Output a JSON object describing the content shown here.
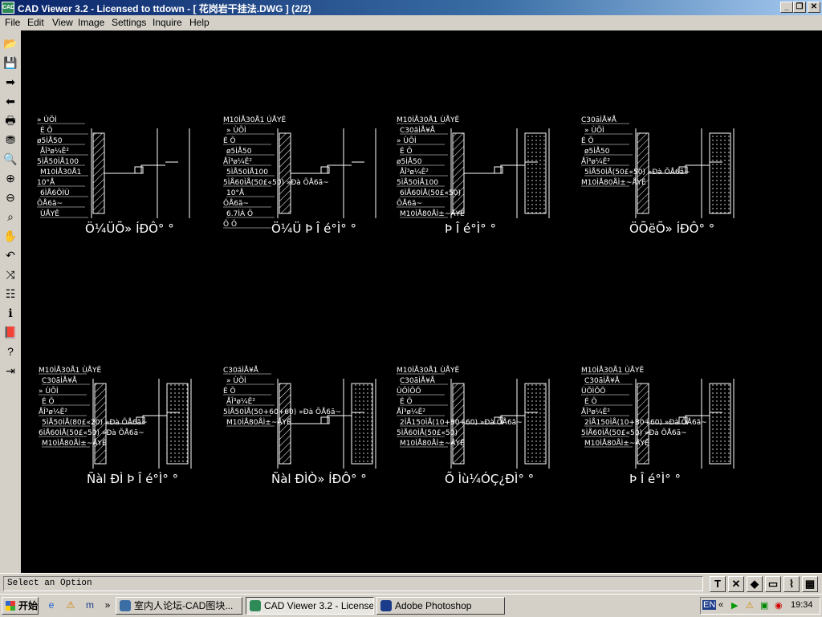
{
  "window": {
    "title": "CAD Viewer 3.2 - Licensed to  ttdown  - [ 花岗岩干挂法.DWG ] (2/2)",
    "app_icon": "CAD",
    "controls": [
      "_",
      "❐",
      "✕"
    ]
  },
  "menu": [
    "File",
    "Edit",
    "View",
    "Image",
    "Settings",
    "Inquire",
    "Help"
  ],
  "toolbar": [
    {
      "icon": "open-icon",
      "glyph": "📂"
    },
    {
      "icon": "save-icon",
      "glyph": "💾"
    },
    {
      "icon": "next-arrow-icon",
      "glyph": "➡"
    },
    {
      "icon": "prev-arrow-icon",
      "glyph": "⬅"
    },
    {
      "icon": "print-icon",
      "glyph": "🖶"
    },
    {
      "icon": "binoculars-icon",
      "glyph": "⛃"
    },
    {
      "icon": "zoom-icon",
      "glyph": "🔍"
    },
    {
      "icon": "zoom-in-icon",
      "glyph": "⊕"
    },
    {
      "icon": "zoom-out-icon",
      "glyph": "⊖"
    },
    {
      "icon": "zoom-window-icon",
      "glyph": "⌕"
    },
    {
      "icon": "pan-hand-icon",
      "glyph": "✋"
    },
    {
      "icon": "undo-icon",
      "glyph": "↶"
    },
    {
      "icon": "rotate-icon",
      "glyph": "⤨"
    },
    {
      "icon": "layers-icon",
      "glyph": "☷"
    },
    {
      "icon": "info-icon",
      "glyph": "ℹ"
    },
    {
      "icon": "book-icon",
      "glyph": "📕"
    },
    {
      "icon": "help-icon",
      "glyph": "?"
    },
    {
      "icon": "exit-icon",
      "glyph": "⇥"
    }
  ],
  "drawing": {
    "row1": [
      {
        "caption": "Ö¼ÜÕ» ÍÐÔ°   °",
        "labels": [
          "»  ÙÕÌ",
          "É  Ö",
          "ø5ÌÅ50",
          "ÅÎ³ø¼Ê²",
          "5ÌÅ50ÌÅ100",
          "M10ÌÅ30Å1",
          "10°Å",
          "6ÌÅ6ÖÌÙ",
          "ÔÅ6ã~",
          "ÙÅYÊ"
        ]
      },
      {
        "caption": "Ö¼Ü  Þ  Î   é°Ì°   °",
        "labels": [
          "M10ÌÅ30Å1  ÙÅYÊ",
          "»  ÙÕÌ",
          "É  Ö",
          "ø5ÌÅ50",
          "ÅÎ³ø¼Ê²",
          "5ÌÅ50ÌÅ100",
          "5ÌÅ60ÌÅ(50£«50)  »Ðà  ÕÅ6ã~",
          "10°Å",
          "ÔÅ6ã~",
          "6.7ÌÁ Ö",
          "Ö  Ö"
        ]
      },
      {
        "caption": "Þ  Î   é°Ì°   °",
        "labels": [
          "M10ÌÅ30Å1  ÙÅYÊ",
          "C30ãÌÅ¥Å",
          "»  ÙÕÌ",
          "É  Ö",
          "ø5ÌÅ50",
          "ÅÎ³ø¼Ê²",
          "5ÌÅ50ÌÅ100",
          "6ÌÅ60ÌÅ(50£«50)",
          "ÔÅ6ã~",
          "M10ÌÅ80ÅÌ±~ÅYÊ"
        ]
      },
      {
        "caption": "ÖÕëÕ» ÍÐÔ°   °",
        "labels": [
          "C30ãÌÅ¥Å",
          "»  ÙÕÌ",
          "É  Ö",
          "ø5ÌÅ50",
          "ÅÎ³ø¼Ê²",
          "5ÌÅ50ÌÅ(50£«50)  »Ðà  ÕÅ6ã~",
          "M10ÌÅ80ÅÌ±~ÅYÊ"
        ]
      }
    ],
    "row2": [
      {
        "caption": "Ñàl  ÐÌ  Þ  Î   é°Ì°   °",
        "labels": [
          "M10ÌÅ30Å1  ÙÅYÊ",
          "C30ãÌÅ¥Å",
          "»  ÙÕÌ",
          "É  Ö",
          "ÅÎ³ø¼Ê²",
          "5ÌÅ50ÌÅ(80£«20)  »Ðà  ÕÅ6ã~",
          "6ÌÅ60ÌÅ(50£«50)  »Ðà  ÕÅ6ã~",
          "M10ÌÅ80ÅÌ±~ÅYÊ"
        ]
      },
      {
        "caption": "Ñàl  ÐÌÒ» ÍÐÔ°   °",
        "labels": [
          "C30ãÌÅ¥Å",
          "»  ÙÕÌ",
          "É  Ö",
          "ÅÎ³ø¼Ê²",
          "5ÌÅ50ÌÅ(50+60+60)  »Ðà  ÕÅ6ã~",
          "M10ÌÅ80ÅÌ±~ÅYÊ"
        ]
      },
      {
        "caption": "Õ  Ìù¼ÓÇ¿ÐÌ°   °",
        "labels": [
          "M10ÌÅ30Å1  ÙÅYÊ",
          "C30ãÌÅ¥Å",
          "ÙÕÌÕÖ",
          "É  Ö",
          "ÅÎ³ø¼Ê²",
          "2ÌÅ150ÌÅ(10+80+60)  »Ðà  ÕÅ6ã~",
          "5ÌÅ60ÌÅ(50£«50)",
          "M10ÌÅ80ÅÌ±~ÅYÊ"
        ]
      },
      {
        "caption": "Þ  Î   é°Ì°   °",
        "labels": [
          "M10ÌÅ30Å1  ÙÅYÊ",
          "C30ãÌÅ¥Å",
          "ÙÕÌÕÖ",
          "É  Ö",
          "ÅÎ³ø¼Ê²",
          "2ÌÅ150ÌÅ(10+80+60)  »Ðà  ÕÅ6ã~",
          "5ÌÅ60ÌÅ(50£«50)  »Ðà  ÕÅ6ã~",
          "M10ÌÅ80ÅÌ±~ÅYÊ"
        ]
      }
    ]
  },
  "status": {
    "prompt": "Select an Option",
    "buttons": [
      {
        "name": "text-tool-button",
        "glyph": "T"
      },
      {
        "name": "close-x-button",
        "glyph": "✕"
      },
      {
        "name": "shield-tool-button",
        "glyph": "◆"
      },
      {
        "name": "window-tool-button",
        "glyph": "▭"
      },
      {
        "name": "clip-tool-button",
        "glyph": "⌇"
      },
      {
        "name": "color-tool-button",
        "glyph": "▦"
      }
    ]
  },
  "taskbar": {
    "start_label": "开始",
    "quick_launch": [
      "e",
      "⚠",
      "m",
      "»"
    ],
    "tasks": [
      {
        "label": "室内人论坛-CAD图块...",
        "color": "#3a6ea5"
      },
      {
        "label": "CAD Viewer 3.2 - License...",
        "color": "#2e8b57",
        "active": true
      },
      {
        "label": "Adobe Photoshop",
        "color": "#1a3a8a"
      }
    ],
    "tray_lang": "EN",
    "tray_chevron": "«",
    "tray_icons": [
      "▶",
      "⚠",
      "▣",
      "◉"
    ],
    "clock": "19:34"
  },
  "colors": {
    "canvas": "#000000",
    "lines": "#ffffff",
    "titlebar_start": "#0a246a"
  }
}
